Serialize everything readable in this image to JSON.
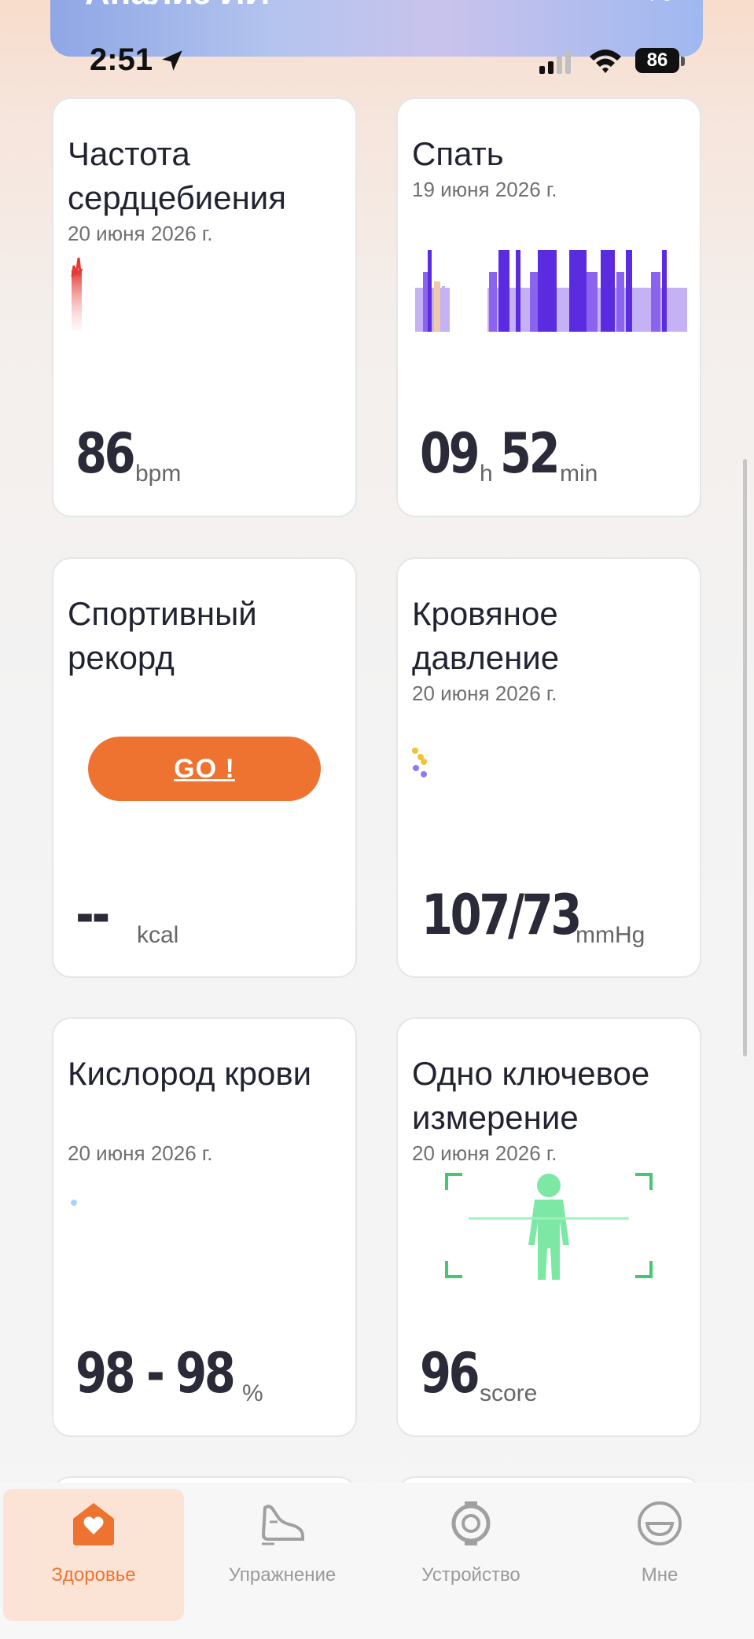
{
  "banner": {
    "text": "Анализ ИИ",
    "right": "%"
  },
  "status_bar": {
    "time": "2:51",
    "battery": "86"
  },
  "cards": {
    "heart_rate": {
      "title": "Частота сердцебиения",
      "date": "20 июня 2026 г.",
      "value": "86",
      "unit": "bpm"
    },
    "sleep": {
      "title": "Спать",
      "date": "19 июня 2026 г.",
      "hours": "09",
      "h_unit": "h",
      "minutes": "52",
      "m_unit": "min"
    },
    "sport": {
      "title": "Спортивный рекорд",
      "button": "GO !",
      "value": "--",
      "unit": "kcal"
    },
    "blood_pressure": {
      "title": "Кровяное давление",
      "date": "20 июня 2026 г.",
      "value": "107/73",
      "unit": "mmHg"
    },
    "oxygen": {
      "title": "Кислород крови",
      "date": "20 июня 2026 г.",
      "value": "98 - 98",
      "unit": "%"
    },
    "one_key": {
      "title": "Одно ключевое измерение",
      "date": "20 июня 2026 г.",
      "value": "96",
      "unit": "score"
    }
  },
  "nav": {
    "items": [
      {
        "label": "Здоровье",
        "icon": "home-heart-icon",
        "active": true
      },
      {
        "label": "Упражнение",
        "icon": "sneaker-icon",
        "active": false
      },
      {
        "label": "Устройство",
        "icon": "watch-icon",
        "active": false
      },
      {
        "label": "Мне",
        "icon": "profile-face-icon",
        "active": false
      }
    ]
  },
  "colors": {
    "accent": "#ee7331",
    "sleep_deep": "#5b2be0",
    "sleep_light": "#c4b2f4",
    "heart": "#e53935",
    "figure": "#7de8a5"
  }
}
